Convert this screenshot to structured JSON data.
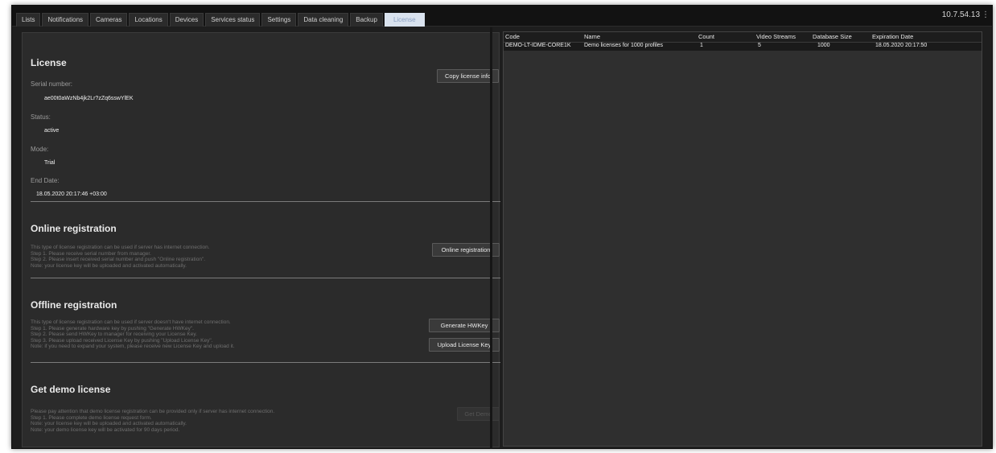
{
  "tabs": [
    {
      "label": "Lists",
      "active": false
    },
    {
      "label": "Notifications",
      "active": false
    },
    {
      "label": "Cameras",
      "active": false
    },
    {
      "label": "Locations",
      "active": false
    },
    {
      "label": "Devices",
      "active": false
    },
    {
      "label": "Services status",
      "active": false
    },
    {
      "label": "Settings",
      "active": false
    },
    {
      "label": "Data cleaning",
      "active": false
    },
    {
      "label": "Backup",
      "active": false
    },
    {
      "label": "License",
      "active": true
    }
  ],
  "server_ip": "10.7.54.13",
  "menu_glyph": "⋮",
  "license": {
    "heading": "License",
    "copy_button": "Copy license info",
    "serial_label": "Serial number:",
    "serial_value": "ae00t0aWzNb4jk2Lr?zZq6sswYlEK",
    "status_label": "Status:",
    "status_value": "active",
    "mode_label": "Mode:",
    "mode_value": "Trial",
    "end_label": "End Date:",
    "end_value": "18.05.2020 20:17:46 +03:00"
  },
  "online": {
    "heading": "Online registration",
    "button": "Online registration",
    "lines": [
      "This type of license registration can be used if server has internet connection.",
      "Step 1. Please receive serial number from manager.",
      "Step 2. Please insert received serial number and push \"Online registration\".",
      "Note: your license key will be uploaded and activated automatically."
    ]
  },
  "offline": {
    "heading": "Offline registration",
    "generate_button": "Generate HWKey",
    "upload_button": "Upload License Key",
    "lines": [
      "This type of license registration can be used if server doesn't have internet connection.",
      "Step 1. Please generate hardware key by pushing \"Generate HWKey\".",
      "Step 2. Please send HWKey to manager for receiving your License Key.",
      "Step 3. Please upload received License Key by pushing \"Upload License Key\".",
      "Note: if you need to expand your system, please receive new License Key and upload it."
    ]
  },
  "demo": {
    "heading": "Get demo license",
    "button": "Get Demo",
    "lines": [
      "Please pay attention that demo license registration can be provided only if server has internet connection.",
      "Step 1. Please complete demo license request form.",
      "Note: your license key will be uploaded and activated automatically.",
      "Note: your demo license key will be activated for 90 days period."
    ]
  },
  "table": {
    "columns": [
      "Code",
      "Name",
      "Count",
      "Video Streams",
      "Database Size",
      "Expiration Date"
    ],
    "rows": [
      [
        "DEMO-LT-IDME-CORE1K",
        "Demo licenses for 1000 profiles",
        "1",
        "5",
        "1000",
        "18.05.2020 20:17:50"
      ]
    ]
  },
  "colors": {
    "background": "#1e1e1e",
    "panel": "#2b2b2b",
    "active_tab": "#d9e2ee",
    "active_tab_text": "#8aa0c2"
  }
}
